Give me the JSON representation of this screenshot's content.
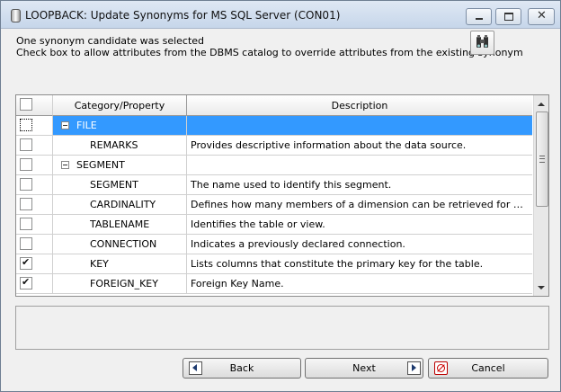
{
  "window": {
    "title": "LOOPBACK: Update Synonyms for MS SQL Server (CON01)"
  },
  "messages": {
    "line1": "One synonym candidate was selected",
    "line2": "Check box to allow attributes from the DBMS catalog to override attributes from the existing synonym"
  },
  "grid": {
    "columns": [
      "Category/Property",
      "Description"
    ],
    "rows": [
      {
        "property": "FILE",
        "description": "",
        "checked": false,
        "type": "category",
        "selected": true
      },
      {
        "property": "REMARKS",
        "description": "Provides descriptive information about the data source.",
        "checked": false,
        "type": "property"
      },
      {
        "property": "SEGMENT",
        "description": "",
        "checked": false,
        "type": "category"
      },
      {
        "property": "SEGMENT",
        "description": "The name used to identify this segment.",
        "checked": false,
        "type": "property"
      },
      {
        "property": "CARDINALITY",
        "description": "Defines how many members of a dimension can be retrieved for a re...",
        "checked": false,
        "type": "property"
      },
      {
        "property": "TABLENAME",
        "description": "Identifies the table or view.",
        "checked": false,
        "type": "property"
      },
      {
        "property": "CONNECTION",
        "description": "Indicates a previously declared connection.",
        "checked": false,
        "type": "property"
      },
      {
        "property": "KEY",
        "description": "Lists columns that constitute the primary key for the table.",
        "checked": true,
        "type": "property"
      },
      {
        "property": "FOREIGN_KEY",
        "description": "Foreign Key Name.",
        "checked": true,
        "type": "property"
      }
    ]
  },
  "buttons": {
    "back": "Back",
    "next": "Next",
    "cancel": "Cancel"
  },
  "colors": {
    "selection": "#3399ff",
    "window_bg": "#f0f0f0"
  },
  "icons": {
    "find": "binoculars-icon",
    "back": "arrow-left-icon",
    "next": "arrow-right-icon",
    "cancel": "cancel-icon"
  }
}
